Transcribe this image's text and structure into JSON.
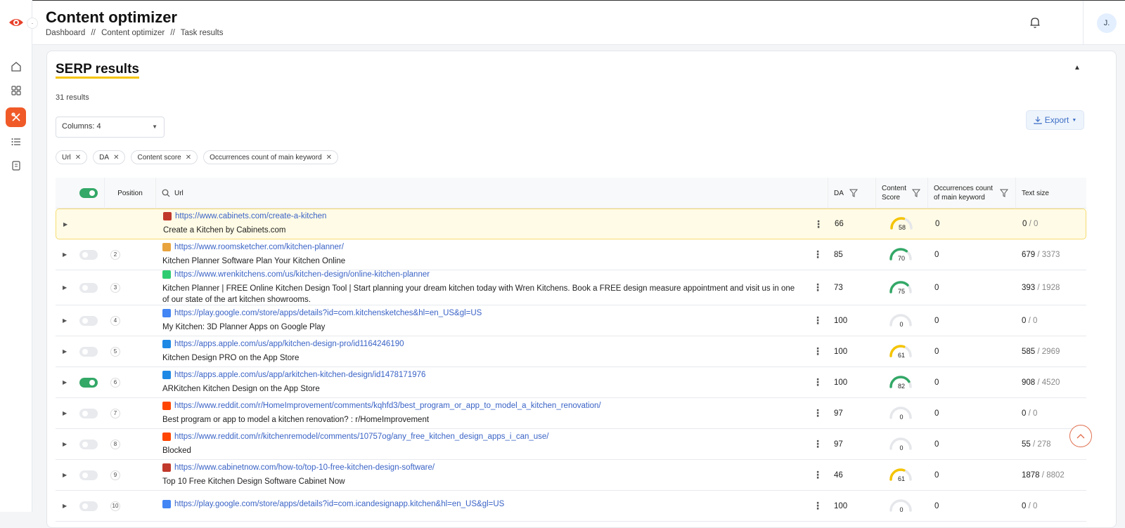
{
  "header": {
    "title": "Content optimizer",
    "breadcrumb": [
      "Dashboard",
      "//",
      "Content optimizer",
      "//",
      "Task results"
    ],
    "avatar_initial": "J."
  },
  "sidebar": {
    "collapse_glyph": "·",
    "items": [
      {
        "icon": "home-icon"
      },
      {
        "icon": "grid-icon"
      },
      {
        "icon": "tools-icon",
        "active": true
      },
      {
        "icon": "list-icon"
      },
      {
        "icon": "document-icon"
      }
    ]
  },
  "colors": {
    "brand": "#f05a28",
    "toggle_on": "#33a867",
    "link": "#3a63c6",
    "highlight": "#fffbe6"
  },
  "card": {
    "title": "SERP results",
    "count": "31 results",
    "columns_select": "Columns: 4",
    "export_label": "Export",
    "chips": [
      "Url",
      "DA",
      "Content score",
      "Occurrences count of main keyword"
    ]
  },
  "table": {
    "headers": {
      "position": "Position",
      "url": "Url",
      "da": "DA",
      "content_score_1": "Content",
      "content_score_2": "Score",
      "occ_1": "Occurrences count",
      "occ_2": "of main keyword",
      "text_size": "Text size"
    },
    "rows": [
      {
        "pos": "",
        "on": false,
        "highlight": true,
        "fav": "#c0392b",
        "url": "https://www.cabinets.com/create-a-kitchen",
        "title": "Create a Kitchen by Cabinets.com",
        "da": "66",
        "score": 58,
        "occ": "0",
        "size": "0",
        "total": "0"
      },
      {
        "pos": "2",
        "on": false,
        "fav": "#e8a33d",
        "url": "https://www.roomsketcher.com/kitchen-planner/",
        "title": "Kitchen Planner Software Plan Your Kitchen Online",
        "da": "85",
        "score": 70,
        "occ": "0",
        "size": "679",
        "total": "3373"
      },
      {
        "pos": "3",
        "on": false,
        "fav": "#2ecc71",
        "url": "https://www.wrenkitchens.com/us/kitchen-design/online-kitchen-planner",
        "title": "Kitchen Planner | FREE Online Kitchen Design Tool | Start planning your dream kitchen today with Wren Kitchens. Book a FREE design measure appointment and visit us in one of our state of the art kitchen showrooms.",
        "da": "73",
        "score": 75,
        "occ": "0",
        "size": "393",
        "total": "1928"
      },
      {
        "pos": "4",
        "on": false,
        "fav": "#4285f4",
        "url": "https://play.google.com/store/apps/details?id=com.kitchensketches&hl=en_US&gl=US",
        "title": "My Kitchen: 3D Planner Apps on Google Play",
        "da": "100",
        "score": 0,
        "occ": "0",
        "size": "0",
        "total": "0"
      },
      {
        "pos": "5",
        "on": false,
        "fav": "#1e88e5",
        "url": "https://apps.apple.com/us/app/kitchen-design-pro/id1164246190",
        "title": "Kitchen Design PRO on the App Store",
        "da": "100",
        "score": 61,
        "occ": "0",
        "size": "585",
        "total": "2969"
      },
      {
        "pos": "6",
        "on": true,
        "fav": "#1e88e5",
        "url": "https://apps.apple.com/us/app/arkitchen-kitchen-design/id1478171976",
        "title": "ARKitchen Kitchen Design on the App Store",
        "da": "100",
        "score": 82,
        "occ": "0",
        "size": "908",
        "total": "4520"
      },
      {
        "pos": "7",
        "on": false,
        "fav": "#ff4500",
        "url": "https://www.reddit.com/r/HomeImprovement/comments/kqhfd3/best_program_or_app_to_model_a_kitchen_renovation/",
        "title": "Best program or app to model a kitchen renovation? : r/HomeImprovement",
        "da": "97",
        "score": 0,
        "occ": "0",
        "size": "0",
        "total": "0"
      },
      {
        "pos": "8",
        "on": false,
        "fav": "#ff4500",
        "url": "https://www.reddit.com/r/kitchenremodel/comments/10757og/any_free_kitchen_design_apps_i_can_use/",
        "title": "Blocked",
        "da": "97",
        "score": 0,
        "occ": "0",
        "size": "55",
        "total": "278"
      },
      {
        "pos": "9",
        "on": false,
        "fav": "#c0392b",
        "url": "https://www.cabinetnow.com/how-to/top-10-free-kitchen-design-software/",
        "title": "Top 10 Free Kitchen Design Software Cabinet Now",
        "da": "46",
        "score": 61,
        "occ": "0",
        "size": "1878",
        "total": "8802"
      },
      {
        "pos": "10",
        "on": false,
        "fav": "#4285f4",
        "url": "https://play.google.com/store/apps/details?id=com.icandesignapp.kitchen&hl=en_US&gl=US",
        "title": "",
        "da": "100",
        "score": 0,
        "occ": "0",
        "size": "0",
        "total": "0"
      }
    ]
  }
}
